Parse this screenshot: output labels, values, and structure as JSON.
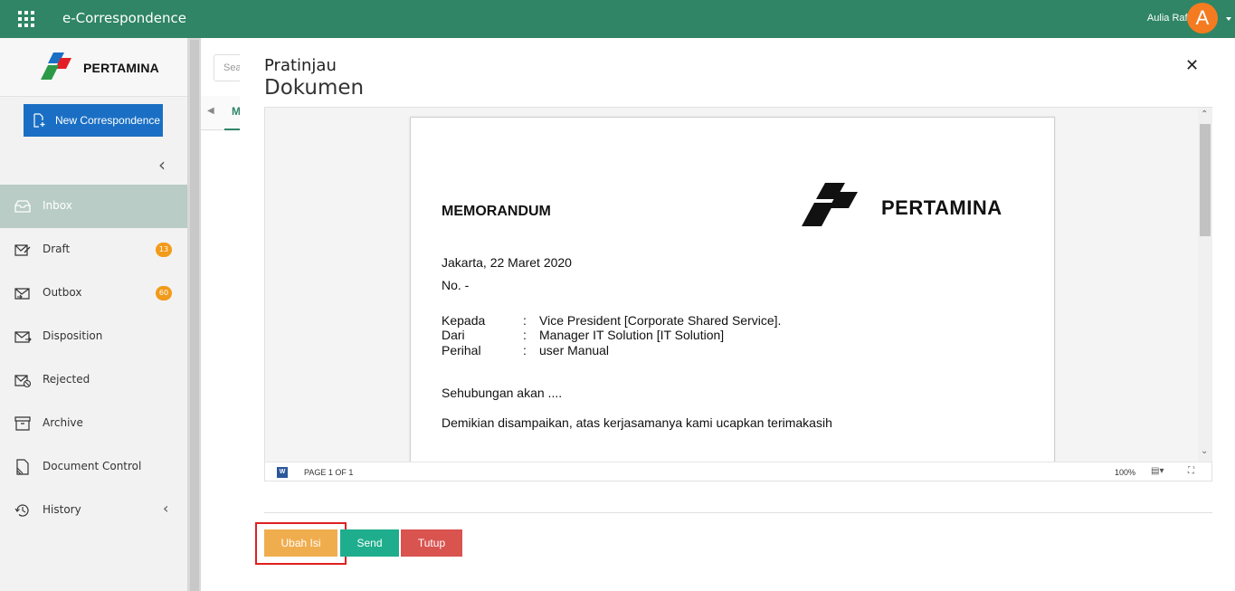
{
  "header": {
    "app_title": "e-Correspondence",
    "user_name": "Aulia Rafi",
    "avatar_initial": "A",
    "bar_color": "#2f8566"
  },
  "sidebar": {
    "logo_text": "PERTAMINA",
    "new_button_label": "New Correspondence",
    "items": [
      {
        "label": "Inbox",
        "icon": "inbox-icon",
        "active": true
      },
      {
        "label": "Draft",
        "icon": "draft-icon",
        "badge": "13"
      },
      {
        "label": "Outbox",
        "icon": "outbox-icon",
        "badge": "60"
      },
      {
        "label": "Disposition",
        "icon": "disposition-icon"
      },
      {
        "label": "Rejected",
        "icon": "rejected-icon"
      },
      {
        "label": "Archive",
        "icon": "archive-icon"
      },
      {
        "label": "Document Control",
        "icon": "document-control-icon"
      },
      {
        "label": "History",
        "icon": "history-icon"
      }
    ]
  },
  "background": {
    "search_placeholder": "Sea",
    "first_tab": "M"
  },
  "modal": {
    "title_line1": "Pratinjau",
    "title_line2": "Dokumen",
    "close_glyph": "✕",
    "document": {
      "memo_title": "MEMORANDUM",
      "logo_text": "PERTAMINA",
      "place_date": "Jakarta, 22 Maret 2020",
      "number": "No. -",
      "fields": [
        {
          "label": "Kepada",
          "value": "Vice President [Corporate Shared Service]."
        },
        {
          "label": "Dari",
          "value": "Manager IT Solution [IT Solution]"
        },
        {
          "label": "Perihal",
          "value": "user Manual"
        }
      ],
      "body_line1": "Sehubungan akan ....",
      "body_line2": "Demikian disampaikan, atas kerjasamanya kami ucapkan terimakasih"
    },
    "status_bar": {
      "page_count": "PAGE 1 OF 1",
      "zoom": "100%"
    },
    "buttons": {
      "ubah": "Ubah Isi",
      "send": "Send",
      "tutup": "Tutup"
    }
  }
}
